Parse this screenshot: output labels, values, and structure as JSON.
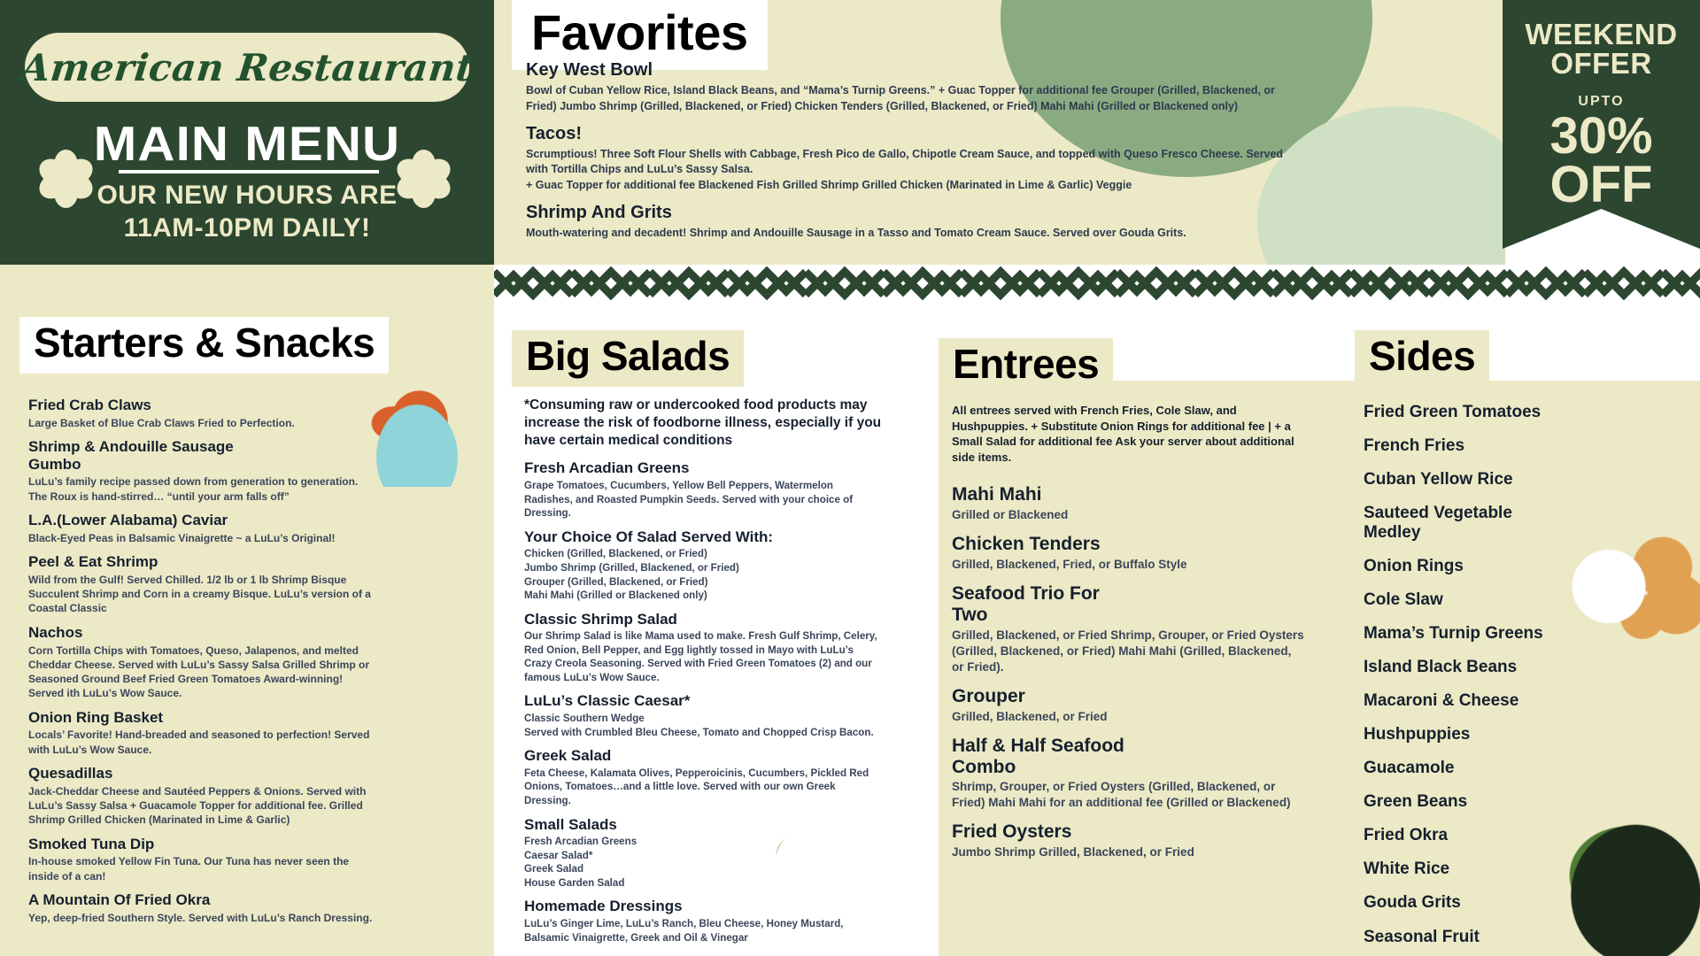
{
  "brand": {
    "name": "American Restaurant",
    "menu_title": "MAIN MENU",
    "hours_line1": "OUR NEW HOURS ARE",
    "hours_line2": "11AM-10PM DAILY!",
    "flower_icon": "flower-icon",
    "bg_color": "#2c4630",
    "cream_color": "#ece9c6"
  },
  "offer": {
    "line1": "WEEKEND",
    "line2": "OFFER",
    "upto": "UPTO",
    "percent": "30%",
    "off": "OFF"
  },
  "favorites": {
    "title": "Favorites",
    "items": [
      {
        "name": "Key West Bowl",
        "desc": "Bowl of Cuban Yellow Rice, Island Black Beans, and “Mama’s Turnip Greens.” + Guac Topper for additional fee Grouper (Grilled, Blackened, or Fried) Jumbo Shrimp (Grilled, Blackened, or Fried) Chicken Tenders (Grilled, Blackened, or Fried) Mahi Mahi (Grilled or Blackened only)"
      },
      {
        "name": "Tacos!",
        "desc": "Scrumptious! Three Soft Flour Shells with Cabbage, Fresh Pico de Gallo, Chipotle Cream Sauce, and topped with Queso Fresco Cheese. Served with Tortilla Chips and LuLu’s Sassy Salsa.\n+ Guac Topper for additional fee Blackened Fish Grilled Shrimp Grilled Chicken (Marinated in Lime & Garlic) Veggie"
      },
      {
        "name": "Shrimp And Grits",
        "desc": "Mouth-watering and decadent! Shrimp and Andouille Sausage in a Tasso and Tomato Cream Sauce. Served over Gouda Grits."
      }
    ]
  },
  "starters": {
    "title": "Starters & Snacks",
    "items": [
      {
        "name": "Fried Crab Claws",
        "desc": "Large Basket of Blue Crab Claws Fried to Perfection."
      },
      {
        "name": "Shrimp & Andouille Sausage Gumbo",
        "desc": "LuLu’s family recipe passed down from generation to generation. The Roux is hand-stirred… “until your arm falls off”"
      },
      {
        "name": "L.A.(Lower Alabama) Caviar",
        "desc": "Black-Eyed Peas in Balsamic Vinaigrette ~ a LuLu’s Original!"
      },
      {
        "name": "Peel & Eat Shrimp",
        "desc": "Wild from the Gulf! Served Chilled. 1/2 lb or 1 lb Shrimp Bisque Succulent Shrimp and Corn in a creamy Bisque. LuLu’s version of a Coastal Classic"
      },
      {
        "name": "Nachos",
        "desc": "Corn Tortilla Chips with Tomatoes, Queso, Jalapenos, and melted Cheddar Cheese. Served with LuLu’s Sassy Salsa Grilled Shrimp or Seasoned Ground Beef Fried Green Tomatoes Award-winning! Served ith LuLu’s Wow Sauce."
      },
      {
        "name": "Onion Ring Basket",
        "desc": "Locals’ Favorite! Hand-breaded and seasoned to perfection! Served with LuLu’s Wow Sauce."
      },
      {
        "name": "Quesadillas",
        "desc": "Jack-Cheddar Cheese and Sautéed Peppers & Onions. Served with LuLu’s Sassy Salsa + Guacamole Topper for additional fee. Grilled Shrimp Grilled Chicken (Marinated in Lime & Garlic)"
      },
      {
        "name": "Smoked Tuna Dip",
        "desc": "In-house smoked Yellow Fin Tuna. Our Tuna has never seen the inside of a can!"
      },
      {
        "name": "A Mountain Of Fried Okra",
        "desc": "Yep, deep-fried Southern Style. Served with LuLu’s Ranch Dressing."
      }
    ]
  },
  "salads": {
    "title": "Big Salads",
    "disclaimer": "*Consuming raw or undercooked food products may increase the risk of foodborne illness, especially if you have certain medical conditions",
    "items": [
      {
        "name": "Fresh Arcadian Greens",
        "desc": "Grape Tomatoes, Cucumbers, Yellow Bell Peppers, Watermelon Radishes, and Roasted Pumpkin Seeds. Served with your choice of Dressing."
      },
      {
        "name": "Your Choice Of Salad Served With:",
        "desc": "Chicken (Grilled, Blackened, or Fried)\nJumbo Shrimp (Grilled, Blackened, or Fried)\nGrouper (Grilled, Blackened, or Fried)\nMahi Mahi (Grilled or Blackened only)"
      },
      {
        "name": "Classic Shrimp Salad",
        "desc": "Our Shrimp Salad is like Mama used to make. Fresh Gulf Shrimp, Celery, Red Onion, Bell Pepper, and Egg lightly tossed in Mayo with LuLu’s Crazy Creola Seasoning. Served with Fried Green Tomatoes (2) and our famous LuLu’s Wow Sauce."
      },
      {
        "name": "LuLu’s Classic Caesar*",
        "desc": "Classic Southern Wedge\nServed with Crumbled Bleu Cheese, Tomato and Chopped Crisp Bacon."
      },
      {
        "name": "Greek Salad",
        "desc": "Feta Cheese, Kalamata Olives, Pepperoicinis, Cucumbers, Pickled Red Onions, Tomatoes…and a little love. Served with our own Greek Dressing."
      },
      {
        "name": "Small Salads",
        "desc": "Fresh Arcadian Greens\nCaesar Salad*\nGreek Salad\nHouse Garden Salad"
      },
      {
        "name": "Homemade Dressings",
        "desc": "LuLu’s Ginger Lime, LuLu’s Ranch, Bleu Cheese, Honey Mustard, Balsamic Vinaigrette, Greek and Oil & Vinegar"
      }
    ]
  },
  "entrees": {
    "title": "Entrees",
    "note": "All entrees served with French Fries, Cole Slaw, and Hushpuppies. + Substitute Onion Rings for additional fee | + a Small Salad for additional fee Ask your server about additional side items.",
    "items": [
      {
        "name": "Mahi Mahi",
        "desc": "Grilled or Blackened"
      },
      {
        "name": "Chicken Tenders",
        "desc": "Grilled, Blackened, Fried, or Buffalo Style"
      },
      {
        "name": "Seafood Trio For Two",
        "desc": "Grilled, Blackened, or Fried Shrimp, Grouper, or Fried Oysters (Grilled, Blackened, or Fried) Mahi Mahi (Grilled, Blackened, or Fried)."
      },
      {
        "name": "Grouper",
        "desc": "Grilled, Blackened, or Fried"
      },
      {
        "name": "Half & Half Seafood Combo",
        "desc": "Shrimp, Grouper, or Fried Oysters (Grilled, Blackened, or Fried) Mahi Mahi for an additional fee (Grilled or Blackened)"
      },
      {
        "name": "Fried Oysters",
        "desc": "Jumbo Shrimp Grilled, Blackened, or Fried"
      }
    ]
  },
  "sides": {
    "title": "Sides",
    "items": [
      "Fried Green Tomatoes",
      "French Fries",
      "Cuban Yellow Rice",
      "Sauteed Vegetable Medley",
      "Onion Rings",
      "Cole Slaw",
      "Mama’s Turnip Greens",
      "Island Black Beans",
      "Macaroni & Cheese",
      "Hushpuppies",
      "Guacamole",
      "Green Beans",
      "Fried Okra",
      "White Rice",
      "Gouda Grits",
      "Seasonal Fruit"
    ]
  }
}
